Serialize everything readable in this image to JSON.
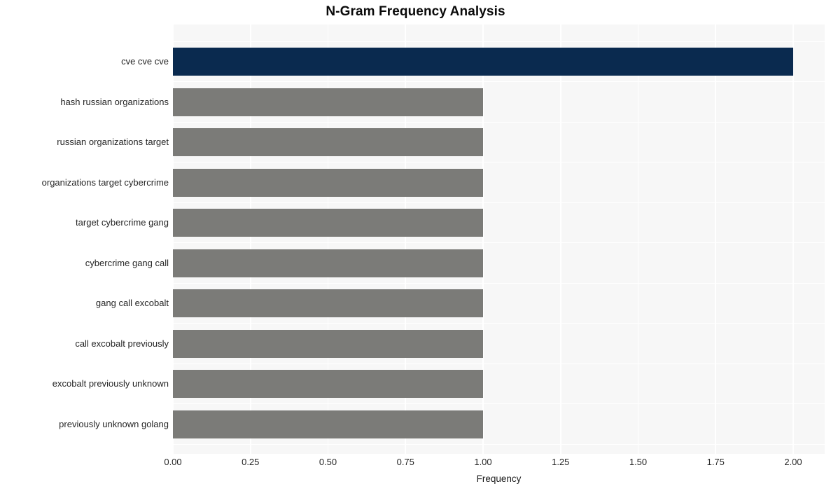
{
  "chart_data": {
    "type": "bar",
    "orientation": "horizontal",
    "title": "N-Gram Frequency Analysis",
    "xlabel": "Frequency",
    "ylabel": "",
    "categories": [
      "cve cve cve",
      "hash russian organizations",
      "russian organizations target",
      "organizations target cybercrime",
      "target cybercrime gang",
      "cybercrime gang call",
      "gang call excobalt",
      "call excobalt previously",
      "excobalt previously unknown",
      "previously unknown golang"
    ],
    "values": [
      2,
      1,
      1,
      1,
      1,
      1,
      1,
      1,
      1,
      1
    ],
    "bar_colors": [
      "#0a2a4f",
      "#7b7b78",
      "#7b7b78",
      "#7b7b78",
      "#7b7b78",
      "#7b7b78",
      "#7b7b78",
      "#7b7b78",
      "#7b7b78",
      "#7b7b78"
    ],
    "xlim": [
      0.0,
      2.0
    ],
    "xticks": [
      0.0,
      0.25,
      0.5,
      0.75,
      1.0,
      1.25,
      1.5,
      1.75,
      2.0
    ],
    "xtick_labels": [
      "0.00",
      "0.25",
      "0.50",
      "0.75",
      "1.00",
      "1.25",
      "1.50",
      "1.75",
      "2.00"
    ],
    "grid": true,
    "grid_color": "#ffffff",
    "plot_background": "#f7f7f7",
    "figure_background": "#ffffff",
    "legend": null,
    "highlight_color": "#0a2a4f",
    "default_color": "#7b7b78"
  }
}
